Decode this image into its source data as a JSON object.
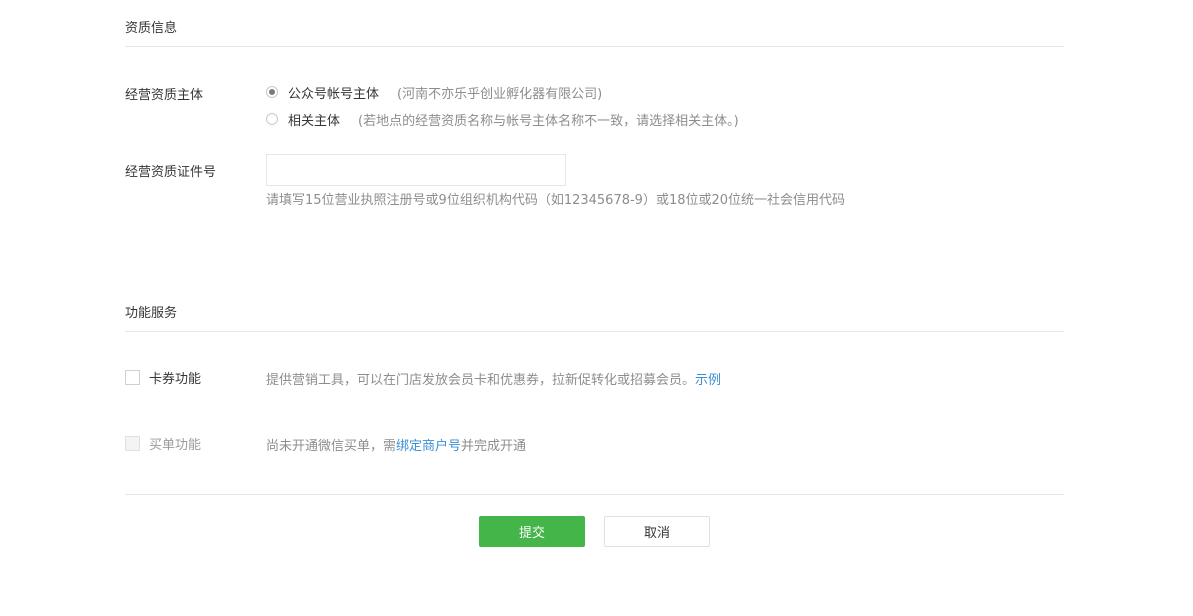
{
  "qualification": {
    "title": "资质信息",
    "subject_label": "经营资质主体",
    "options": [
      {
        "label": "公众号帐号主体",
        "note": "(河南不亦乐乎创业孵化器有限公司)",
        "checked": true
      },
      {
        "label": "相关主体",
        "note": "(若地点的经营资质名称与帐号主体名称不一致，请选择相关主体。)",
        "checked": false
      }
    ],
    "cert_label": "经营资质证件号",
    "cert_value": "",
    "cert_hint": "请填写15位营业执照注册号或9位组织机构代码（如12345678-9）或18位或20位统一社会信用代码"
  },
  "services": {
    "title": "功能服务",
    "card": {
      "label": "卡券功能",
      "desc": "提供营销工具，可以在门店发放会员卡和优惠券，拉新促转化或招募会员。",
      "link": "示例"
    },
    "pay": {
      "label": "买单功能",
      "desc_prefix": "尚未开通微信买单，需",
      "link": "绑定商户号",
      "desc_suffix": "并完成开通"
    }
  },
  "actions": {
    "submit": "提交",
    "cancel": "取消"
  }
}
